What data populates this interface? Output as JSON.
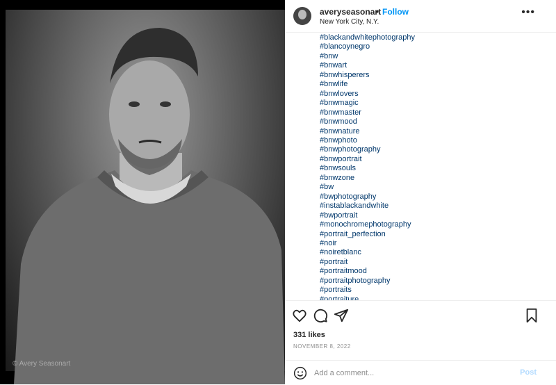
{
  "photo": {
    "watermark": "© Avery Seasonart"
  },
  "header": {
    "username": "averyseasonart",
    "separator": "•",
    "follow_label": "Follow",
    "location": "New York City, N.Y.",
    "more_label": "•••"
  },
  "caption": {
    "hashtags": [
      "#blackandwhitephotography",
      "#blancoynegro",
      "#bnw",
      "#bnwart",
      "#bnwhisperers",
      "#bnwlife",
      "#bnwlovers",
      "#bnwmagic",
      "#bnwmaster",
      "#bnwmood",
      "#bnwnature",
      "#bnwphoto",
      "#bnwphotography",
      "#bnwportrait",
      "#bnwsouls",
      "#bnwzone",
      "#bw",
      "#bwphotography",
      "#instablackandwhite",
      "#bwportrait",
      "#monochromephotography",
      "#portrait_perfection",
      "#noir",
      "#noiretblanc",
      "#portrait",
      "#portraitmood",
      "#portraitphotography",
      "#portraits",
      "#portraiture"
    ]
  },
  "actions": {
    "icons": [
      "heart-icon",
      "comment-icon",
      "share-icon",
      "bookmark-icon"
    ]
  },
  "stats": {
    "likes": "331 likes",
    "date": "NOVEMBER 8, 2022"
  },
  "comment": {
    "placeholder": "Add a comment...",
    "post_label": "Post"
  },
  "colors": {
    "link": "#00376b",
    "follow": "#0095f6",
    "post_disabled": "#b3dbff"
  }
}
